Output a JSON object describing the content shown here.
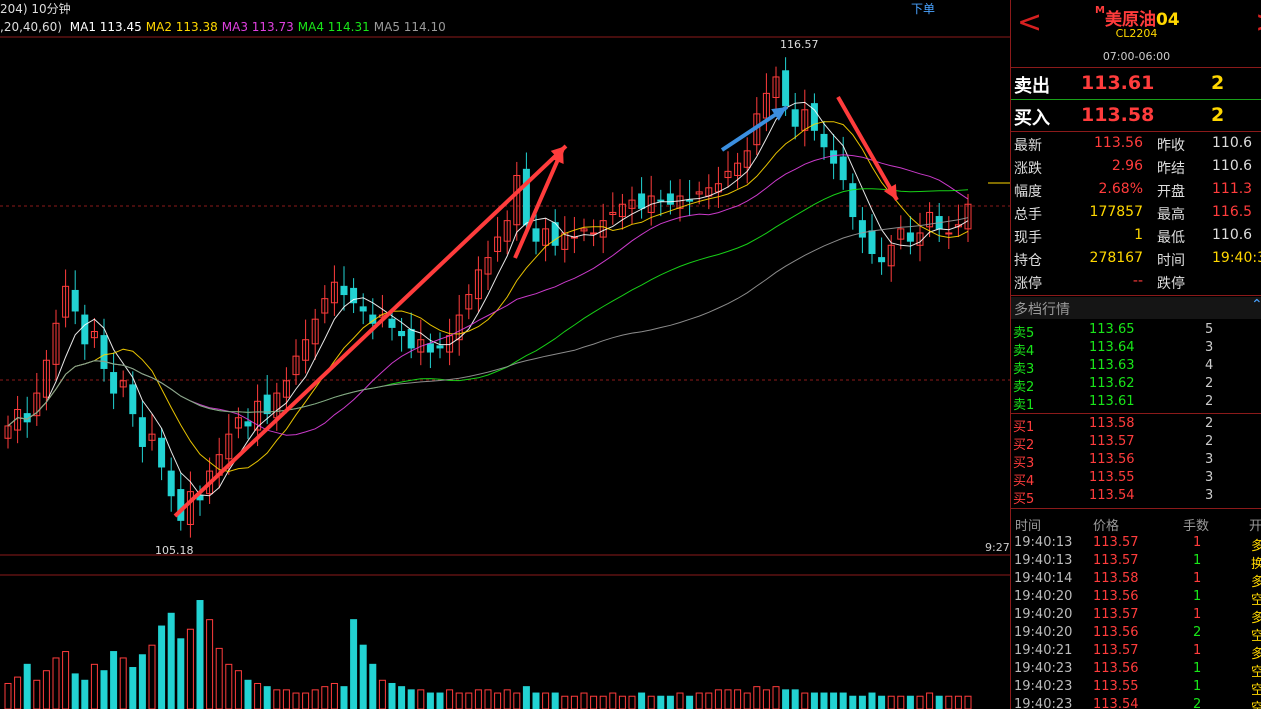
{
  "chart": {
    "partial_params": ",20,40,60)",
    "partial_period": "204) 10分钟",
    "ma": [
      {
        "label": "MA1",
        "value": "113.45",
        "color": "#ffffff"
      },
      {
        "label": "MA2",
        "value": "113.38",
        "color": "#ffd700"
      },
      {
        "label": "MA3",
        "value": "113.73",
        "color": "#e040e0"
      },
      {
        "label": "MA4",
        "value": "114.31",
        "color": "#19e619"
      },
      {
        "label": "MA5",
        "value": "114.10",
        "color": "#9a9a9a"
      }
    ],
    "order_link": "下单",
    "high_label": "116.57",
    "low_label": "105.18",
    "time_label": "9:27",
    "colors": {
      "up": "#ff3c3c",
      "down": "#22d3d3",
      "grid": "#8b1a1a"
    }
  },
  "chart_data": {
    "type": "candlestick",
    "ylim": [
      104.9,
      117.2
    ],
    "high": 116.57,
    "low": 105.18,
    "close_prices": [
      107.8,
      108.2,
      107.9,
      108.6,
      109.4,
      110.3,
      111.2,
      110.6,
      109.8,
      110.1,
      109.2,
      108.6,
      108.9,
      108.1,
      107.3,
      107.6,
      106.8,
      106.1,
      105.5,
      106.2,
      106.0,
      106.7,
      107.1,
      107.6,
      108.0,
      107.8,
      108.4,
      108.1,
      108.6,
      108.9,
      109.5,
      109.9,
      110.4,
      110.9,
      111.3,
      111.0,
      110.8,
      110.6,
      110.3,
      110.5,
      110.2,
      110.0,
      109.7,
      109.9,
      109.6,
      109.7,
      110.0,
      110.5,
      111.0,
      111.6,
      111.9,
      112.4,
      112.8,
      113.9,
      112.7,
      112.3,
      112.6,
      112.2,
      112.5,
      112.4,
      112.6,
      112.5,
      112.8,
      113.0,
      113.2,
      113.3,
      113.1,
      113.4,
      113.3,
      113.2,
      113.4,
      113.3,
      113.5,
      113.6,
      113.7,
      114.0,
      114.2,
      114.5,
      115.4,
      115.9,
      116.3,
      115.6,
      115.1,
      115.5,
      115.0,
      114.6,
      114.2,
      113.8,
      112.9,
      112.4,
      112.0,
      111.8,
      112.2,
      112.6,
      112.3,
      112.5,
      113.0,
      112.6,
      112.5,
      112.7,
      113.2
    ],
    "volumes": [
      8,
      10,
      14,
      9,
      12,
      16,
      18,
      11,
      9,
      14,
      12,
      18,
      16,
      13,
      17,
      20,
      26,
      30,
      22,
      25,
      34,
      28,
      19,
      14,
      12,
      9,
      8,
      7,
      6,
      6,
      5,
      5,
      6,
      7,
      8,
      7,
      28,
      20,
      14,
      9,
      8,
      7,
      6,
      6,
      5,
      5,
      6,
      5,
      5,
      6,
      6,
      5,
      6,
      5,
      7,
      5,
      5,
      5,
      4,
      4,
      5,
      4,
      4,
      5,
      4,
      4,
      5,
      4,
      4,
      4,
      5,
      4,
      5,
      5,
      6,
      6,
      6,
      5,
      7,
      6,
      7,
      6,
      6,
      5,
      5,
      5,
      5,
      5,
      4,
      4,
      5,
      4,
      4,
      4,
      4,
      4,
      5,
      4,
      4,
      4,
      4
    ],
    "series": [
      {
        "name": "MA1",
        "color": "#ffffff"
      },
      {
        "name": "MA2",
        "color": "#ffd700"
      },
      {
        "name": "MA3",
        "color": "#e040e0"
      },
      {
        "name": "MA4",
        "color": "#19e619"
      },
      {
        "name": "MA5",
        "color": "#9a9a9a"
      }
    ]
  },
  "quote": {
    "symbol_prefix": "M",
    "symbol_name": "美原油",
    "symbol_month": "04",
    "code": "CL2204",
    "session": "07:00-06:00",
    "nav_prev": "<",
    "nav_next": ">",
    "sell_label": "卖出",
    "sell_price": "113.61",
    "sell_volume": "2",
    "buy_label": "买入",
    "buy_price": "113.58",
    "buy_volume": "2",
    "stats": [
      {
        "l1": "最新",
        "v1": "113.56",
        "c1": "red",
        "l2": "昨收",
        "v2": "110.6",
        "c2": "white"
      },
      {
        "l1": "涨跌",
        "v1": "2.96",
        "c1": "red",
        "l2": "昨结",
        "v2": "110.6",
        "c2": "white"
      },
      {
        "l1": "幅度",
        "v1": "2.68%",
        "c1": "red",
        "l2": "开盘",
        "v2": "111.3",
        "c2": "red"
      },
      {
        "l1": "总手",
        "v1": "177857",
        "c1": "yellow",
        "l2": "最高",
        "v2": "116.5",
        "c2": "red"
      },
      {
        "l1": "现手",
        "v1": "1",
        "c1": "yellow",
        "l2": "最低",
        "v2": "110.6",
        "c2": "white"
      },
      {
        "l1": "持仓",
        "v1": "278167",
        "c1": "yellow",
        "l2": "时间",
        "v2": "19:40:3",
        "c2": "yellow"
      },
      {
        "l1": "涨停",
        "v1": "--",
        "c1": "red",
        "l2": "跌停",
        "v2": "",
        "c2": "white"
      }
    ],
    "depth_title": "多档行情",
    "depth_toggle": "⌃",
    "asks": [
      {
        "label": "卖5",
        "price": "113.65",
        "vol": "5"
      },
      {
        "label": "卖4",
        "price": "113.64",
        "vol": "3"
      },
      {
        "label": "卖3",
        "price": "113.63",
        "vol": "4"
      },
      {
        "label": "卖2",
        "price": "113.62",
        "vol": "2"
      },
      {
        "label": "卖1",
        "price": "113.61",
        "vol": "2"
      }
    ],
    "bids": [
      {
        "label": "买1",
        "price": "113.58",
        "vol": "2"
      },
      {
        "label": "买2",
        "price": "113.57",
        "vol": "2"
      },
      {
        "label": "买3",
        "price": "113.56",
        "vol": "3"
      },
      {
        "label": "买4",
        "price": "113.55",
        "vol": "3"
      },
      {
        "label": "买5",
        "price": "113.54",
        "vol": "3"
      }
    ],
    "ticks_headers": {
      "time": "时间",
      "price": "价格",
      "qty": "手数",
      "open": "开"
    },
    "ticks": [
      {
        "time": "19:40:13",
        "price": "113.57",
        "pc": "red",
        "qty": "1",
        "qc": "red",
        "open": "多"
      },
      {
        "time": "19:40:13",
        "price": "113.57",
        "pc": "red",
        "qty": "1",
        "qc": "green",
        "open": "换"
      },
      {
        "time": "19:40:14",
        "price": "113.58",
        "pc": "red",
        "qty": "1",
        "qc": "red",
        "open": "多"
      },
      {
        "time": "19:40:20",
        "price": "113.56",
        "pc": "red",
        "qty": "1",
        "qc": "green",
        "open": "空"
      },
      {
        "time": "19:40:20",
        "price": "113.57",
        "pc": "red",
        "qty": "1",
        "qc": "red",
        "open": "多"
      },
      {
        "time": "19:40:20",
        "price": "113.56",
        "pc": "red",
        "qty": "2",
        "qc": "green",
        "open": "空"
      },
      {
        "time": "19:40:21",
        "price": "113.57",
        "pc": "red",
        "qty": "1",
        "qc": "red",
        "open": "多"
      },
      {
        "time": "19:40:23",
        "price": "113.56",
        "pc": "red",
        "qty": "1",
        "qc": "green",
        "open": "空"
      },
      {
        "time": "19:40:23",
        "price": "113.55",
        "pc": "red",
        "qty": "1",
        "qc": "green",
        "open": "空"
      },
      {
        "time": "19:40:23",
        "price": "113.54",
        "pc": "red",
        "qty": "2",
        "qc": "green",
        "open": "空"
      }
    ]
  }
}
